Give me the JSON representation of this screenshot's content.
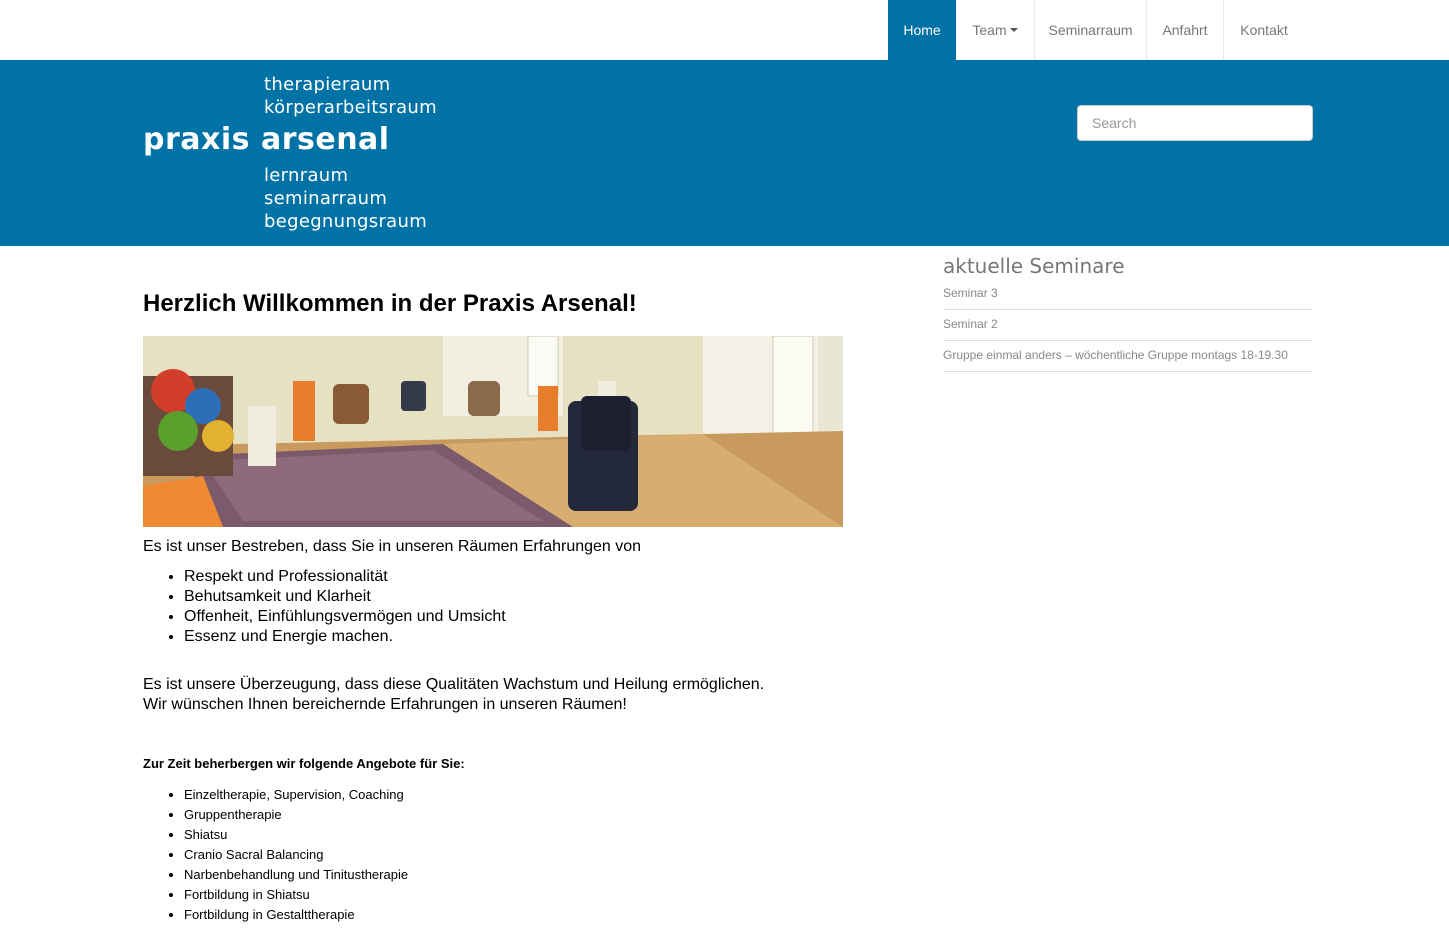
{
  "nav": {
    "home": "Home",
    "team": "Team",
    "seminarraum": "Seminarraum",
    "anfahrt": "Anfahrt",
    "kontakt": "Kontakt"
  },
  "logo": {
    "line1": "therapieraum",
    "line2": "körperarbeitsraum",
    "brand": "praxis arsenal",
    "line3": "lernraum",
    "line4": "seminarraum",
    "line5": "begegnungsraum"
  },
  "search": {
    "placeholder": "Search"
  },
  "main": {
    "title": "Herzlich Willkommen in der Praxis Arsenal!",
    "intro": "Es ist unser Bestreben, dass Sie in unseren Räumen Erfahrungen von",
    "values": [
      "Respekt und Professionalität",
      "Behutsamkeit und Klarheit",
      "Offenheit, Einfühlungsvermögen und Umsicht",
      "Essenz und Energie machen."
    ],
    "belief1": "Es ist unsere Überzeugung, dass diese Qualitäten Wachstum und Heilung ermöglichen.",
    "belief2": "Wir wünschen Ihnen bereichernde Erfahrungen in unseren Räumen!",
    "offers_heading": "Zur Zeit beherbergen wir folgende Angebote für Sie:",
    "offers": [
      "Einzeltherapie, Supervision, Coaching",
      "Gruppentherapie",
      "Shiatsu",
      "Cranio Sacral Balancing",
      "Narbenbehandlung und Tinitustherapie",
      "Fortbildung in Shiatsu",
      "Fortbildung in Gestalttherapie"
    ]
  },
  "sidebar": {
    "title": "aktuelle Seminare",
    "items": [
      "Seminar 3",
      "Seminar 2",
      "Gruppe einmal anders – wöchentliche Gruppe montags 18-19.30"
    ]
  },
  "colors": {
    "brand": "#0072a6",
    "nav_text": "#777777",
    "sidebar_text": "#888888"
  }
}
